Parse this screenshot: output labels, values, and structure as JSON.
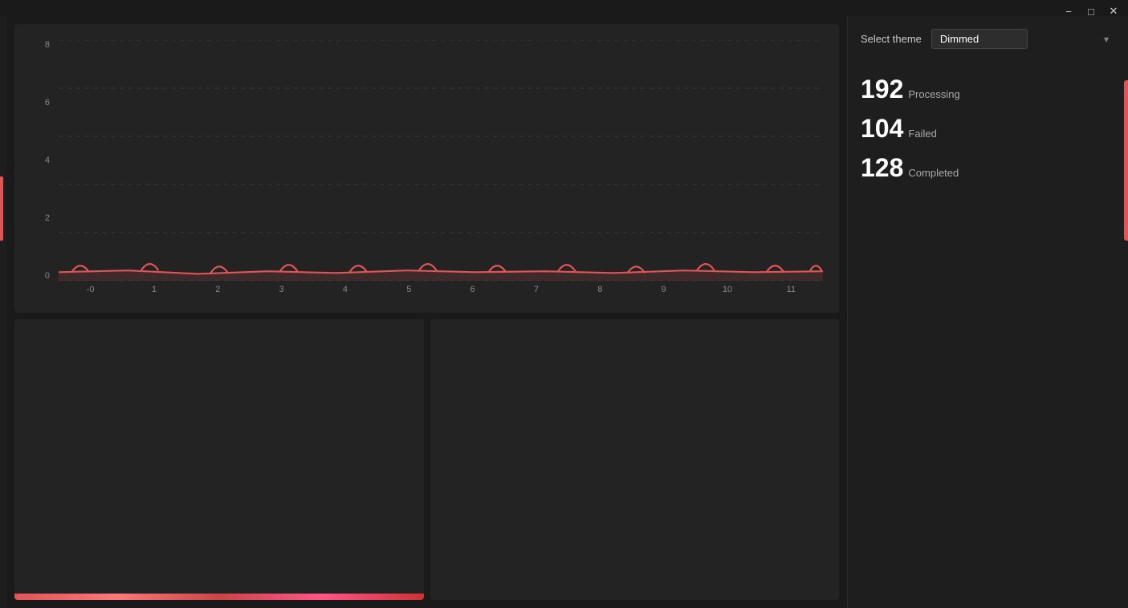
{
  "titlebar": {
    "minimize_label": "−",
    "maximize_label": "□",
    "close_label": "✕"
  },
  "theme": {
    "label": "Select theme",
    "selected": "Dimmed"
  },
  "stats": [
    {
      "number": "192",
      "label": "Processing"
    },
    {
      "number": "104",
      "label": "Failed"
    },
    {
      "number": "128",
      "label": "Completed"
    }
  ],
  "chart": {
    "y_labels": [
      "8",
      "6",
      "4",
      "2",
      "0"
    ],
    "x_labels": [
      "-0",
      "1",
      "2",
      "3",
      "4",
      "5",
      "6",
      "7",
      "8",
      "9",
      "10",
      "11"
    ]
  }
}
